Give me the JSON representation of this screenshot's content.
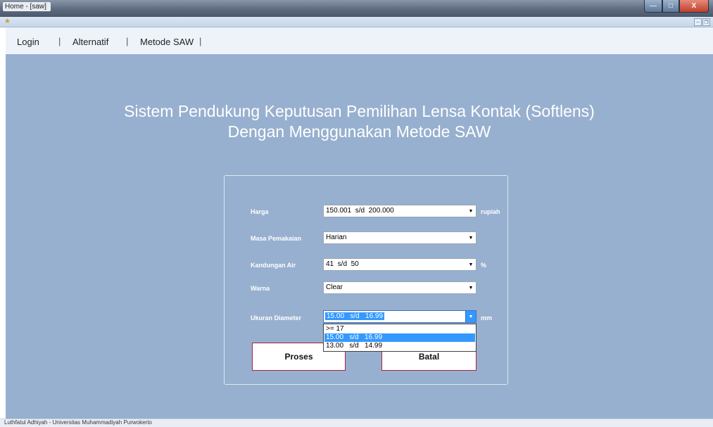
{
  "window": {
    "title": "Home - [saw]",
    "close_glyph": "X"
  },
  "menu": {
    "items": [
      "Login",
      "Alternatif",
      "Metode SAW"
    ],
    "separator": "|"
  },
  "app": {
    "title_line1": "Sistem Pendukung Keputusan Pemilihan Lensa Kontak (Softlens)",
    "title_line2": "Dengan Menggunakan Metode SAW"
  },
  "form": {
    "harga": {
      "label": "Harga",
      "value": "150.001  s/d  200.000",
      "unit": "rupiah"
    },
    "masa": {
      "label": "Masa Pemakaian",
      "value": "Harian"
    },
    "kandungan": {
      "label": "Kandungan Air",
      "value": "41  s/d  50",
      "unit": "%"
    },
    "warna": {
      "label": "Warna",
      "value": "Clear"
    },
    "diameter": {
      "label": "Ukuran Diameter",
      "value": "15.00   s/d   16.99",
      "unit": "mm",
      "options": [
        ">= 17",
        "15.00   s/d   16.99",
        "13.00   s/d   14.99"
      ],
      "selected_index": 1
    }
  },
  "buttons": {
    "proses": "Proses",
    "batal": "Batal"
  },
  "status": {
    "text": "Luthfatul Adhiyah - Universitas Muhammadiyah Purwokerto"
  },
  "colors": {
    "panel": "#97b0cf",
    "highlight": "#3399ff",
    "button_border": "#a8243f"
  }
}
